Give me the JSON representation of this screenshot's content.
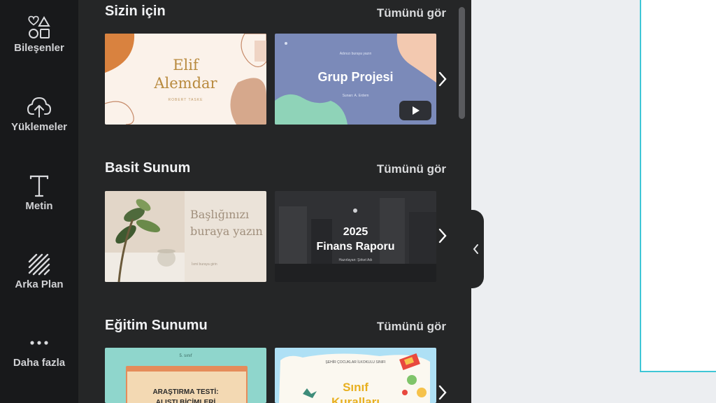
{
  "sidebar": {
    "items": [
      {
        "label": "Bileşenler",
        "icon": "shapes-icon"
      },
      {
        "label": "Yüklemeler",
        "icon": "cloud-upload-icon"
      },
      {
        "label": "Metin",
        "icon": "text-icon"
      },
      {
        "label": "Arka Plan",
        "icon": "background-pattern-icon"
      },
      {
        "label": "Daha fazla",
        "icon": "more-dots-icon"
      }
    ]
  },
  "sections": [
    {
      "title": "Sizin için",
      "see_all": "Tümünü gör",
      "cards": [
        {
          "title": "Elif\nAlemdar",
          "subtitle": "ROBERT TASKE"
        },
        {
          "title": "Grup Projesi",
          "subtitle": "Sunan: A. Erdem",
          "caption": "Adınızı buraya yazın"
        }
      ]
    },
    {
      "title": "Basit Sunum",
      "see_all": "Tümünü gör",
      "cards": [
        {
          "title": "Başlığınızı\nburaya yazın",
          "subtitle": "İsmi buraya girin"
        },
        {
          "title": "2025\nFinans Raporu",
          "subtitle": "Hazırlayan: Şirket Adı"
        }
      ]
    },
    {
      "title": "Eğitim Sunumu",
      "see_all": "Tümünü gör",
      "cards": [
        {
          "title": "ARAŞTIRMA TESTİ:\nALIŞTI BİÇİMLERİ",
          "tag": "5. sınıf"
        },
        {
          "title": "Sınıf\nKuralları",
          "caption": "ŞEHİR ÇOCUKLAR İLKOKULU SINIFI"
        }
      ]
    }
  ],
  "colors": {
    "rail_bg": "#18191b",
    "panel_bg": "#252627",
    "canvas_border": "#3fc6d6",
    "workspace_bg": "#eceef1"
  }
}
